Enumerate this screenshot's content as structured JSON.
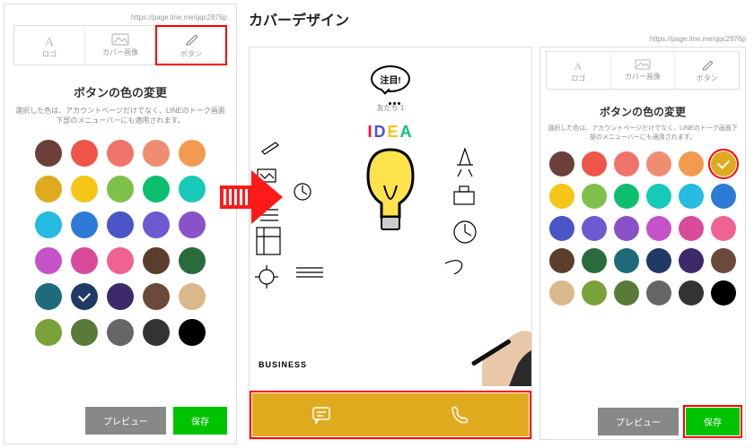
{
  "url": "https://page.line.me/qqc2876p",
  "heading": "カバーデザイン",
  "tabs": [
    {
      "label": "ロゴ"
    },
    {
      "label": "カバー画像"
    },
    {
      "label": "ボタン"
    }
  ],
  "section": {
    "title": "ボタンの色の変更",
    "desc": "選択した色は、アカウントページだけでなく、LINEのトーク画面下部のメニューバーにも適用されます。"
  },
  "colors": [
    "#6b3f3a",
    "#f0554a",
    "#f0736b",
    "#ef8d73",
    "#f29a50",
    "#e0aa1e",
    "#f5c518",
    "#7fc04b",
    "#0bbf6f",
    "#18c9b8",
    "#26bbe0",
    "#2d7bd6",
    "#4a55c7",
    "#6f59d1",
    "#8a52c9",
    "#c452c9",
    "#d94b99",
    "#f06292",
    "#5a3e2b",
    "#2a6b3c",
    "#1e6b7a",
    "#203a66",
    "#3c2a6b",
    "#6b4a3a",
    "#d9b88a",
    "#7aa23a",
    "#5a7a3a",
    "#666666",
    "#333333",
    "#000000"
  ],
  "left_selected_index": 21,
  "right_selected_index": 5,
  "buttons": {
    "preview": "プレビュー",
    "save": "保存"
  },
  "preview": {
    "speech_text": "注目!",
    "friend_label": "友だち 1",
    "idea_text": "IDEA",
    "business_text": "BUSINESS"
  }
}
